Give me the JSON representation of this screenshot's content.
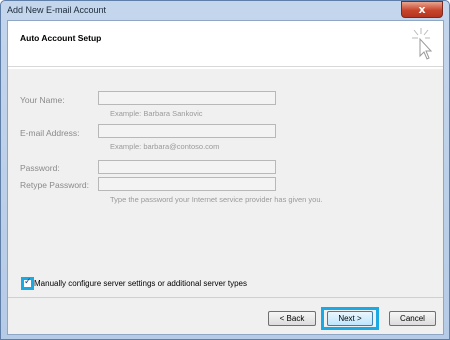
{
  "window": {
    "title": "Add New E-mail Account",
    "close_label": "x"
  },
  "header": {
    "title": "Auto Account Setup"
  },
  "form": {
    "name": {
      "label": "Your Name:",
      "value": "",
      "hint": "Example: Barbara Sankovic"
    },
    "email": {
      "label": "E-mail Address:",
      "value": "",
      "hint": "Example: barbara@contoso.com"
    },
    "password": {
      "label": "Password:",
      "value": ""
    },
    "retype": {
      "label": "Retype Password:",
      "value": "",
      "hint": "Type the password your Internet service provider has given you."
    }
  },
  "manual": {
    "label": "Manually configure server settings or additional server types",
    "checked": true,
    "check_glyph": "✓"
  },
  "buttons": {
    "back": "< Back",
    "next": "Next >",
    "cancel": "Cancel"
  },
  "colors": {
    "highlight": "#1aa9e3",
    "close": "#c8452c"
  }
}
